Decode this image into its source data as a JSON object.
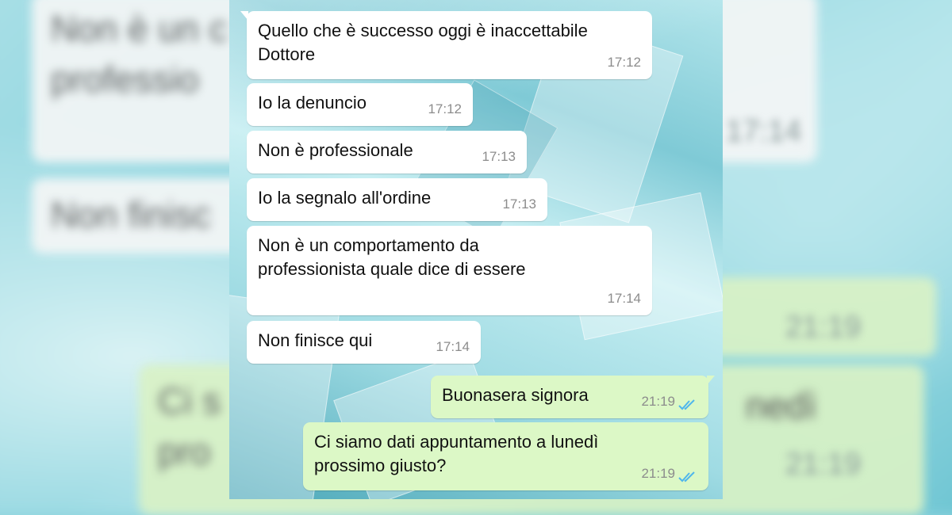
{
  "messages": [
    {
      "text": "Quello che è successo oggi è inaccettabile Dottore",
      "time": "17:12",
      "direction": "incoming"
    },
    {
      "text": "Io la denuncio",
      "time": "17:12",
      "direction": "incoming"
    },
    {
      "text": "Non è professionale",
      "time": "17:13",
      "direction": "incoming"
    },
    {
      "text": "Io la segnalo all'ordine",
      "time": "17:13",
      "direction": "incoming"
    },
    {
      "text": "Non è un comportamento da professionista quale dice di essere",
      "time": "17:14",
      "direction": "incoming"
    },
    {
      "text": "Non finisce qui",
      "time": "17:14",
      "direction": "incoming"
    },
    {
      "text": "Buonasera signora",
      "time": "21:19",
      "direction": "outgoing",
      "status": "read"
    },
    {
      "text": "Ci siamo dati appuntamento a lunedì prossimo giusto?",
      "time": "21:19",
      "direction": "outgoing",
      "status": "read"
    }
  ],
  "blurred_background": {
    "fragments": [
      "Non è un c",
      "professio",
      "Non finisc",
      "Ci s",
      "pro",
      "nedì"
    ],
    "times": [
      "17:14",
      "21:19",
      "21:19"
    ]
  },
  "colors": {
    "incoming_bubble": "#ffffff",
    "outgoing_bubble": "#dcf8c6",
    "read_ticks": "#4fb6ec",
    "timestamp": "#8c8c8c"
  }
}
